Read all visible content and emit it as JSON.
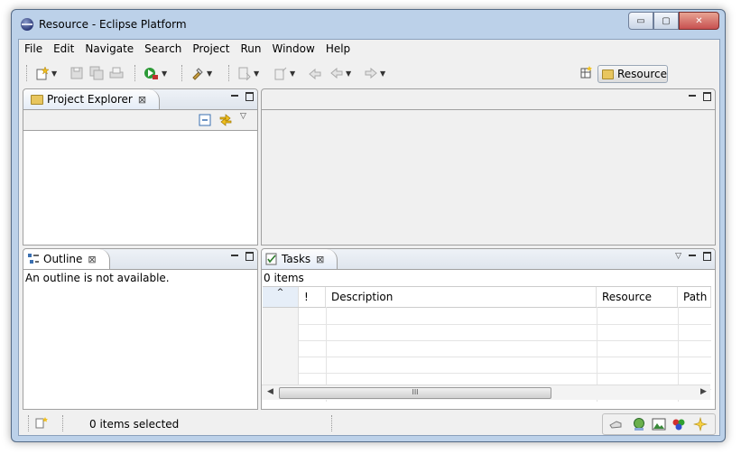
{
  "window": {
    "title": "Resource - Eclipse Platform",
    "minimize": "▭",
    "maximize": "▢",
    "close": "✕"
  },
  "menu": [
    "File",
    "Edit",
    "Navigate",
    "Search",
    "Project",
    "Run",
    "Window",
    "Help"
  ],
  "toolbar": {
    "perspective_label": "Resource"
  },
  "project_explorer": {
    "tab_label": "Project Explorer",
    "close": "⊠"
  },
  "outline": {
    "tab_label": "Outline",
    "close": "⊠",
    "message": "An outline is not available."
  },
  "tasks": {
    "tab_label": "Tasks",
    "close": "⊠",
    "count": "0 items",
    "columns": [
      "",
      "!",
      "Description",
      "Resource",
      "Path"
    ],
    "scroll_grip": "III"
  },
  "status": {
    "selection": "0 items selected"
  },
  "colors": {
    "window_frame": "#bcd1e9",
    "client_bg": "#f0f0f0",
    "close_button": "#c75050",
    "panel_border": "#a0a0a0"
  }
}
